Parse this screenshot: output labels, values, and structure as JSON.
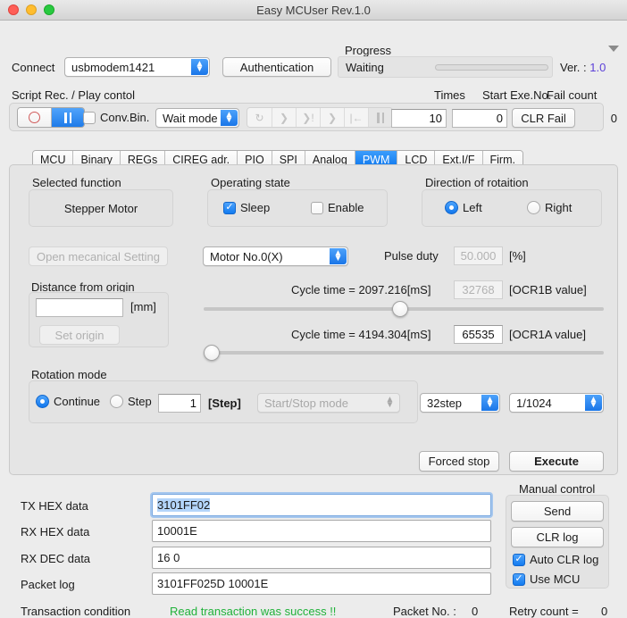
{
  "window": {
    "title": "Easy MCUser Rev.1.0",
    "traffic_lights": [
      "close",
      "minimize",
      "zoom"
    ]
  },
  "header": {
    "connect_label": "Connect",
    "port_value": "usbmodem1421",
    "auth_button": "Authentication",
    "progress_caption": "Progress",
    "progress_status": "Waiting",
    "progress_percent": 0,
    "ver_label": "Ver. : ",
    "ver_value": "1.0",
    "ver_color": "#5b3fd8"
  },
  "script_panel": {
    "title": "Script Rec. / Play contol",
    "record_icon": "record-circle-icon",
    "pause_icon": "pause-icon",
    "conv_bin_label": "Conv.Bin.",
    "conv_bin_checked": false,
    "wait_mode_value": "Wait mode",
    "playback_icons": [
      "loop-icon",
      "step-next-icon",
      "step-break-icon",
      "step-into-icon",
      "rewind-start-icon",
      "pause-icon"
    ],
    "times_label": "Times",
    "times_value": "10",
    "start_exe_label": "Start Exe.No.",
    "start_exe_value": "0",
    "clr_fail_button": "CLR Fail",
    "fail_count_label": "Fail count",
    "fail_count_value": "0"
  },
  "tabs": [
    {
      "label": "MCU",
      "active": false
    },
    {
      "label": "Binary",
      "active": false
    },
    {
      "label": "REGs",
      "active": false
    },
    {
      "label": "CIREG adr.",
      "active": false
    },
    {
      "label": "PIO",
      "active": false
    },
    {
      "label": "SPI",
      "active": false
    },
    {
      "label": "Analog",
      "active": false
    },
    {
      "label": "PWM",
      "active": true
    },
    {
      "label": "LCD",
      "active": false
    },
    {
      "label": "Ext.I/F",
      "active": false
    },
    {
      "label": "Firm.",
      "active": false
    }
  ],
  "pwm": {
    "selected_function_label": "Selected function",
    "selected_function_value": "Stepper Motor",
    "operating_state_label": "Operating state",
    "sleep_label": "Sleep",
    "sleep_checked": true,
    "enable_label": "Enable",
    "enable_checked": false,
    "direction_label": "Direction of rotaition",
    "left_label": "Left",
    "left_selected": true,
    "right_label": "Right",
    "right_selected": false,
    "open_mechanical_button": "Open mecanical Setting",
    "open_mechanical_disabled": true,
    "distance_label": "Distance from origin",
    "distance_value": "",
    "distance_unit": "[mm]",
    "set_origin_button": "Set origin",
    "set_origin_disabled": true,
    "motor_select_value": "Motor No.0(X)",
    "pulse_duty_label": "Pulse duty",
    "pulse_duty_value": "50.000",
    "pulse_duty_unit": "[%]",
    "pulse_duty_disabled": true,
    "cycle_b_label": "Cycle time = 2097.216[mS]",
    "ocr1b_value": "32768",
    "ocr1b_unit": "[OCR1B value]",
    "ocr1b_disabled": true,
    "slider_b_percent": 49,
    "cycle_a_label": "Cycle time = 4194.304[mS]",
    "ocr1a_value": "65535",
    "ocr1a_unit": "[OCR1A value]",
    "slider_a_percent": 0,
    "rotation_mode_label": "Rotation mode",
    "continue_label": "Continue",
    "continue_selected": true,
    "step_label": "Step",
    "step_selected": false,
    "step_value": "1",
    "step_unit": "[Step]",
    "start_stop_value": "Start/Stop mode",
    "start_stop_disabled": true,
    "step_mode_value": "32step",
    "micro_step_value": "1/1024",
    "forced_stop_button": "Forced stop",
    "execute_button": "Execute"
  },
  "data_rows": [
    {
      "label": "TX HEX data",
      "value": "3101FF02",
      "focused": true,
      "selected": true
    },
    {
      "label": "RX HEX data",
      "value": "10001E",
      "focused": false,
      "selected": false
    },
    {
      "label": "RX DEC data",
      "value": "16 0",
      "focused": false,
      "selected": false
    },
    {
      "label": "Packet log",
      "value": "3101FF025D 10001E",
      "focused": false,
      "selected": false
    }
  ],
  "status": {
    "transaction_label": "Transaction condition",
    "transaction_message": "Read transaction was success !!",
    "transaction_color": "#20b23a",
    "packet_no_label": "Packet No. :",
    "packet_no_value": "0",
    "retry_label": "Retry count  =",
    "retry_value": "0"
  },
  "manual_control": {
    "title": "Manual control",
    "send_button": "Send",
    "clr_log_button": "CLR log",
    "auto_clr_label": "Auto CLR log",
    "auto_clr_checked": true,
    "use_mcu_label": "Use MCU",
    "use_mcu_checked": true
  }
}
